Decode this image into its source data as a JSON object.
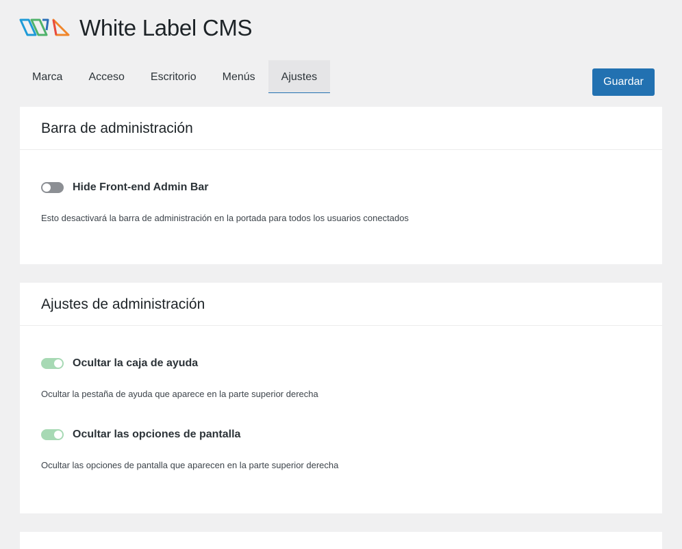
{
  "app": {
    "title": "White Label CMS"
  },
  "tabs": [
    {
      "label": "Marca",
      "active": false
    },
    {
      "label": "Acceso",
      "active": false
    },
    {
      "label": "Escritorio",
      "active": false
    },
    {
      "label": "Menús",
      "active": false
    },
    {
      "label": "Ajustes",
      "active": true
    }
  ],
  "save_button": {
    "label": "Guardar"
  },
  "colors": {
    "accent": "#2271b1",
    "toggle_on": "#a7d9b4",
    "toggle_off": "#8c8f94"
  },
  "sections": [
    {
      "title": "Barra de administración",
      "settings": [
        {
          "label": "Hide Front-end Admin Bar",
          "enabled": false,
          "description": "Esto desactivará la barra de administración en la portada para todos los usuarios conectados"
        }
      ]
    },
    {
      "title": "Ajustes de administración",
      "settings": [
        {
          "label": "Ocultar la caja de ayuda",
          "enabled": true,
          "description": "Ocultar la pestaña de ayuda que aparece en la parte superior derecha"
        },
        {
          "label": "Ocultar las opciones de pantalla",
          "enabled": true,
          "description": "Ocultar las opciones de pantalla que aparecen en la parte superior derecha"
        }
      ]
    }
  ]
}
